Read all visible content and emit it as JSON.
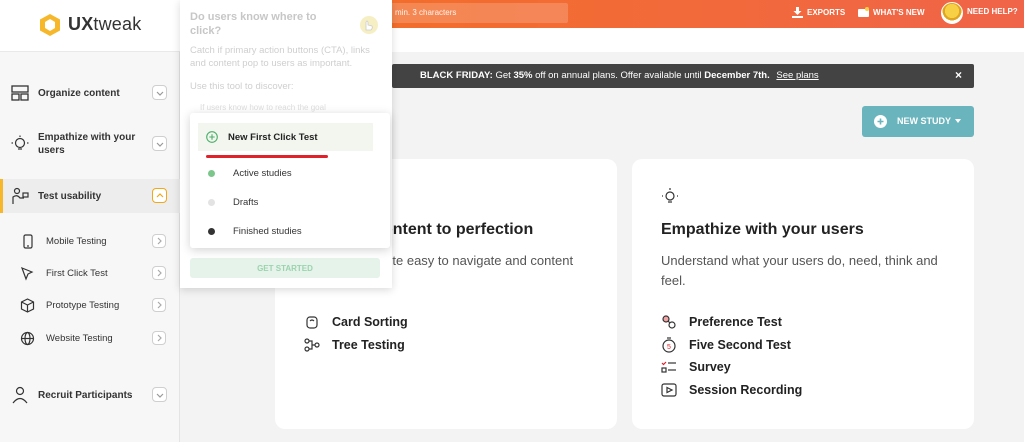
{
  "app": {
    "logo_bold": "UX",
    "logo_light": "tweak"
  },
  "header": {
    "search_hint": "min. 3 characters",
    "exports": "EXPORTS",
    "whats_new": "WHAT'S NEW",
    "need_help": "NEED HELP?"
  },
  "sidebar": {
    "organize": "Organize content",
    "empathize": "Empathize with your users",
    "test_usability": "Test usability",
    "sub": {
      "mobile": "Mobile Testing",
      "first_click": "First Click Test",
      "prototype": "Prototype Testing",
      "website": "Website Testing"
    },
    "recruit": "Recruit Participants"
  },
  "tooltip": {
    "title": "Do users know where to click?",
    "desc": "Catch if primary action buttons (CTA), links and content pop to users as important.",
    "use": "Use this tool to discover:",
    "bullet": "If users know how to reach the goal",
    "button": "GET STARTED"
  },
  "menu": {
    "new": "New First Click Test",
    "active": "Active studies",
    "drafts": "Drafts",
    "finished": "Finished studies"
  },
  "banner": {
    "lead": "BLACK FRIDAY:",
    "text_a": "Get",
    "pct": "35%",
    "text_b": "off on annual plans. Offer available until",
    "date": "December 7th.",
    "link": "See plans",
    "close": "×"
  },
  "new_study": "NEW STUDY",
  "cards": {
    "left": {
      "title": "ontent to perfection",
      "desc": "site easy to navigate and content",
      "tools": [
        "Card Sorting",
        "Tree Testing"
      ]
    },
    "right": {
      "title": "Empathize with your users",
      "desc": "Understand what your users do, need, think and feel.",
      "tools": [
        "Preference Test",
        "Five Second Test",
        "Survey",
        "Session Recording"
      ]
    }
  },
  "colors": {
    "brand_orange": "#f37021",
    "accent_teal": "#69b4bd",
    "active_yellow": "#f7b72a",
    "underline_red": "#e0212a"
  }
}
